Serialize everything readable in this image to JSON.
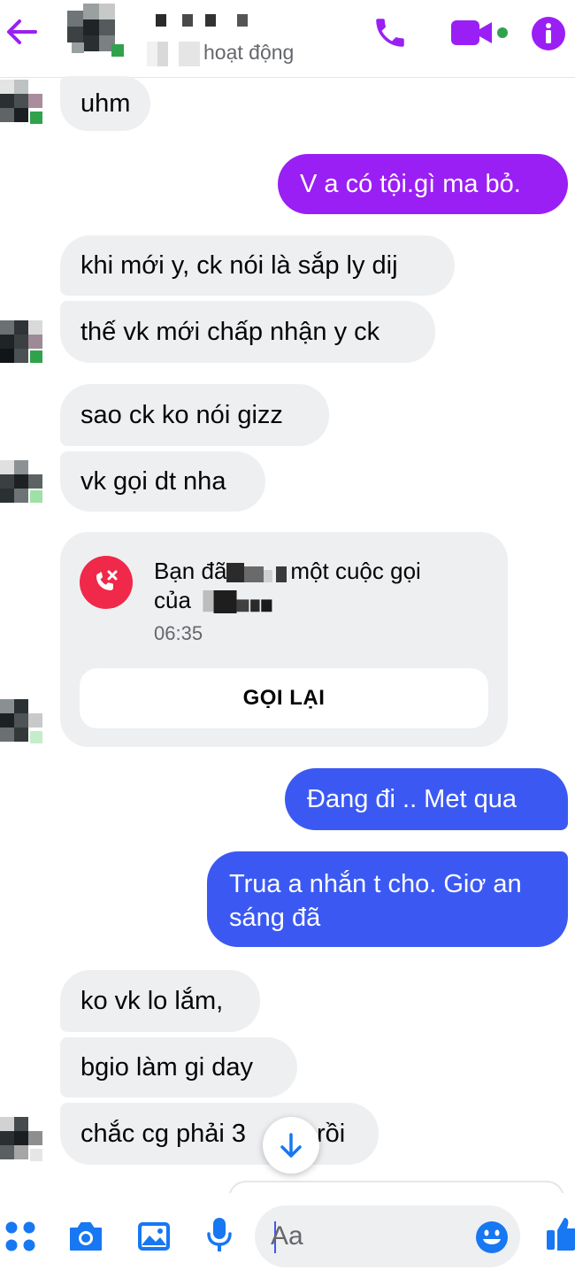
{
  "header": {
    "status_text": "hoạt động",
    "icons": [
      "back-arrow-icon",
      "phone-icon",
      "video-camera-icon",
      "info-icon"
    ],
    "accent_color": "#9a1ff4"
  },
  "messages": [
    {
      "side": "in",
      "text": "uhm"
    },
    {
      "side": "out",
      "text": "V a có tội.gì ma bỏ.",
      "color": "#9a1ff4"
    },
    {
      "side": "in",
      "text": "khi mới y, ck nói là sắp ly dij"
    },
    {
      "side": "in",
      "text": "thế vk mới chấp nhận y ck"
    },
    {
      "side": "in",
      "text": "sao ck ko nói gizz"
    },
    {
      "side": "in",
      "text": "vk gọi dt nha"
    },
    {
      "side": "out",
      "text": "Đang đi .. Met qua",
      "color": "#3b59f2"
    },
    {
      "side": "out",
      "text_line1": "Trua a nhắn t cho. Giơ an",
      "text_line2": "sáng đã",
      "color": "#3b59f2"
    },
    {
      "side": "in",
      "text": "ko vk lo lắm,"
    },
    {
      "side": "in",
      "text": "bgio làm gi day"
    },
    {
      "side": "in",
      "text_before": "chắc cg phải 3",
      "text_after": "rồi"
    }
  ],
  "call_card": {
    "line1_start": "Bạn đã",
    "line1_end": "một cuộc gọi",
    "line2_start": "của",
    "time": "06:35",
    "button_label": "GỌI LẠI",
    "icon": "missed-call-icon",
    "icon_color": "#f02849"
  },
  "composer": {
    "placeholder": "Aa",
    "icons": [
      "menu-dots-icon",
      "camera-icon",
      "image-icon",
      "microphone-icon",
      "emoji-icon",
      "like-icon"
    ],
    "icon_color": "#1877f2"
  }
}
